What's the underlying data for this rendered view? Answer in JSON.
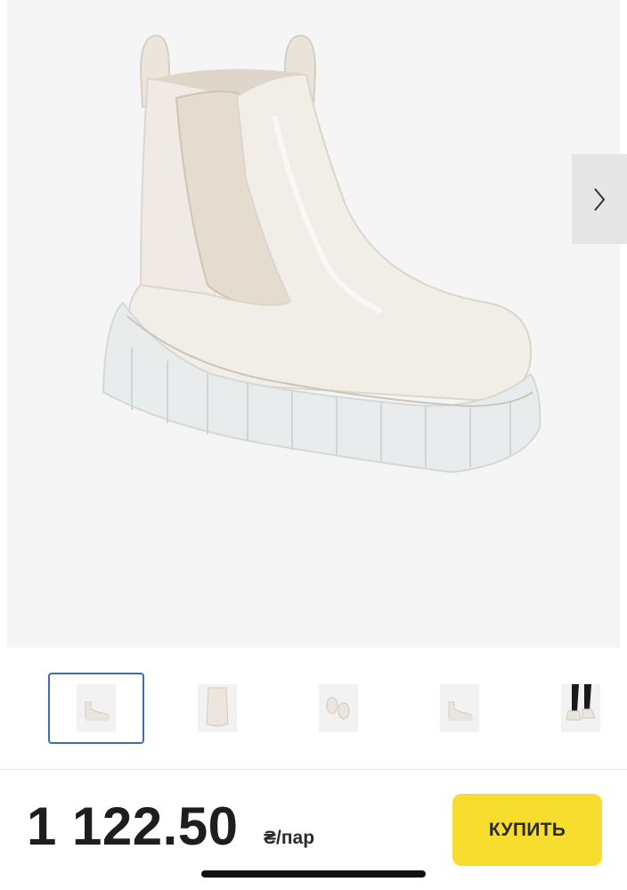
{
  "product": {
    "price": "1 122.50",
    "unit": "₴/пар",
    "buy_label": "КУПИТЬ"
  },
  "gallery": {
    "main_image": "white chelsea boot with translucent chunky sole",
    "next_icon": "chevron-right-icon",
    "thumbnails": [
      {
        "subject": "boot side view",
        "active": true
      },
      {
        "subject": "boot back view",
        "active": false
      },
      {
        "subject": "pair of boots top view",
        "active": false
      },
      {
        "subject": "boot side view",
        "active": false
      },
      {
        "subject": "boots worn with black trousers",
        "active": false
      }
    ]
  },
  "colors": {
    "accent_button": "#f7dd2e",
    "active_thumb_border": "#3f6bb8",
    "gallery_bg": "#f5f5f5"
  }
}
